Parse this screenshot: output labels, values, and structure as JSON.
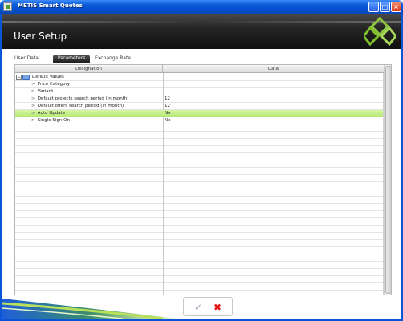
{
  "window": {
    "title": "METIS Smart Quotes"
  },
  "header": {
    "title": "User Setup"
  },
  "tabs": [
    {
      "label": "User Data",
      "active": false
    },
    {
      "label": "Parameters",
      "active": true
    },
    {
      "label": "Exchange Rate",
      "active": false
    }
  ],
  "table": {
    "columns": [
      "Designation",
      "Data"
    ],
    "rows": [
      {
        "designation": "Default Values",
        "data": "",
        "group": true,
        "expanded": true
      },
      {
        "designation": "Price Category",
        "data": "",
        "editable": true
      },
      {
        "designation": "Variant",
        "data": "",
        "editable": true
      },
      {
        "designation": "Default projects search period (in month)",
        "data": "12",
        "editable": true
      },
      {
        "designation": "Default offers search period (in month)",
        "data": "12",
        "editable": true
      },
      {
        "designation": "Auto Update",
        "data": "No",
        "editable": true,
        "selected": true
      },
      {
        "designation": "Single Sign On",
        "data": "No",
        "editable": true
      }
    ]
  },
  "colors": {
    "title_bar": "#0550d0",
    "header_bg": "#1a1a1a",
    "selected_row": "#b2e870",
    "accent_green": "#7fbf2a",
    "cancel_red": "#e01818"
  },
  "icons": {
    "expand": "chevron-right-icon",
    "collapse": "minus-box-icon",
    "group": "folder-icon",
    "edit": "pencil-icon",
    "confirm": "checkmark-icon",
    "cancel": "x-icon"
  }
}
